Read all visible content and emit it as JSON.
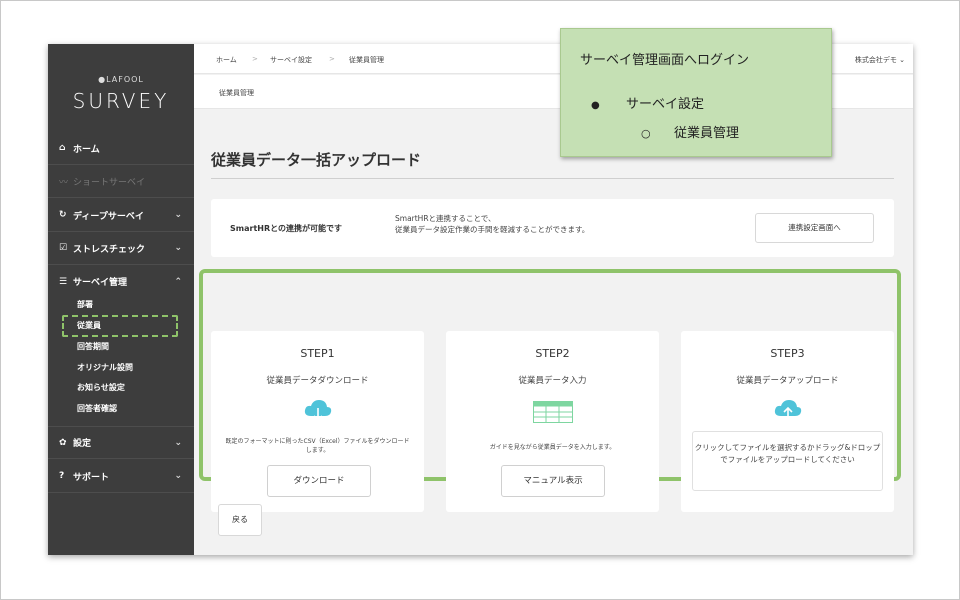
{
  "sidebar": {
    "logo_small": "●LAFOOL",
    "logo_big": "SURVEY",
    "items": [
      {
        "icon": "home-icon",
        "glyph": "⌂",
        "label": "ホーム"
      },
      {
        "icon": "pulse-icon",
        "glyph": "〰",
        "label": "ショートサーベイ"
      },
      {
        "icon": "refresh-icon",
        "glyph": "↻",
        "label": "ディープサーベイ",
        "chevron": "⌄"
      },
      {
        "icon": "checkbox-icon",
        "glyph": "☑",
        "label": "ストレスチェック",
        "chevron": "⌄"
      },
      {
        "icon": "list-icon",
        "glyph": "☰",
        "label": "サーベイ管理",
        "chevron": "⌃"
      },
      {
        "icon": "gear-icon",
        "glyph": "✿",
        "label": "設定",
        "chevron": "⌄"
      },
      {
        "icon": "help-icon",
        "glyph": "?",
        "label": "サポート",
        "chevron": "⌄"
      }
    ],
    "sub_items": [
      "部署",
      "従業員",
      "回答期間",
      "オリジナル設問",
      "お知らせ設定",
      "回答者確認"
    ]
  },
  "header": {
    "breadcrumb": [
      "ホーム",
      "サーベイ設定",
      "従業員管理"
    ],
    "separator": ">",
    "company": "株式会社デモ",
    "company_chevron": "⌄",
    "page_label": "従業員管理"
  },
  "main": {
    "title": "従業員データ一括アップロード",
    "smarthr": {
      "title": "SmartHRとの連携が可能です",
      "desc_line1": "SmartHRと連携することで、",
      "desc_line2": "従業員データ設定作業の手間を軽減することができます。",
      "button": "連携設定画面へ"
    },
    "steps": [
      {
        "title": "STEP1",
        "subtitle": "従業員データダウンロード",
        "icon": "cloud-download-icon",
        "desc": "既定のフォーマットに則ったCSV（Excel）ファイルをダウンロードします。",
        "button": "ダウンロード"
      },
      {
        "title": "STEP2",
        "subtitle": "従業員データ入力",
        "icon": "table-icon",
        "desc": "ガイドを見ながら従業員データを入力します。",
        "button": "マニュアル表示"
      },
      {
        "title": "STEP3",
        "subtitle": "従業員データアップロード",
        "icon": "cloud-upload-icon",
        "dropzone": "クリックしてファイルを選択するかドラッグ&ドロップでファイルをアップロードしてください"
      }
    ],
    "back_button": "戻る"
  },
  "callout": {
    "title": "サーベイ管理画面へログイン",
    "bullet": "サーベイ設定",
    "bullet_mark": "●",
    "sub": "従業員管理",
    "sub_mark": "○"
  },
  "colors": {
    "accent_green": "#8fc36a",
    "sidebar": "#3d3d3d",
    "callout": "#c5e0b4",
    "icon_teal": "#4fc3d9",
    "table_green": "#7ed6a0"
  }
}
